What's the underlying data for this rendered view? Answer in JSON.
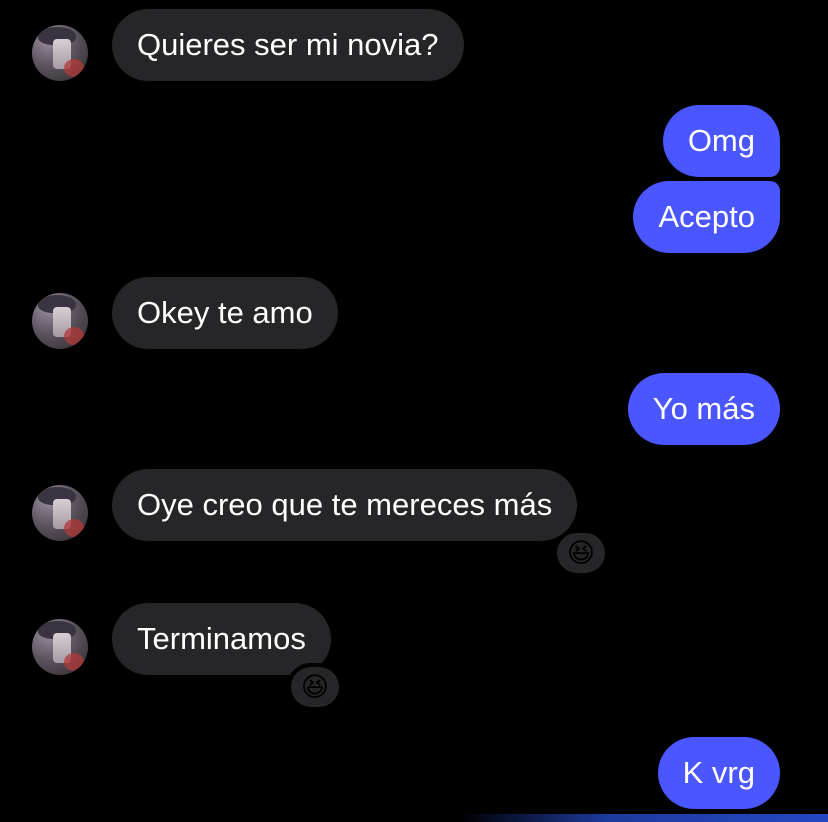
{
  "conversation": {
    "messages": [
      {
        "from": "contact",
        "text": "Quieres ser mi novia?"
      },
      {
        "from": "me",
        "text": "Omg"
      },
      {
        "from": "me",
        "text": "Acepto"
      },
      {
        "from": "contact",
        "text": "Okey te amo"
      },
      {
        "from": "me",
        "text": "Yo más"
      },
      {
        "from": "contact",
        "text": "Oye creo que te mereces más",
        "reaction": "😆"
      },
      {
        "from": "contact",
        "text": "Terminamos",
        "reaction": "😆"
      },
      {
        "from": "me",
        "text": "K vrg"
      }
    ]
  },
  "colors": {
    "background": "#000000",
    "incoming_bubble": "#262628",
    "outgoing_bubble": "#4a56ff",
    "text": "#ffffff"
  }
}
